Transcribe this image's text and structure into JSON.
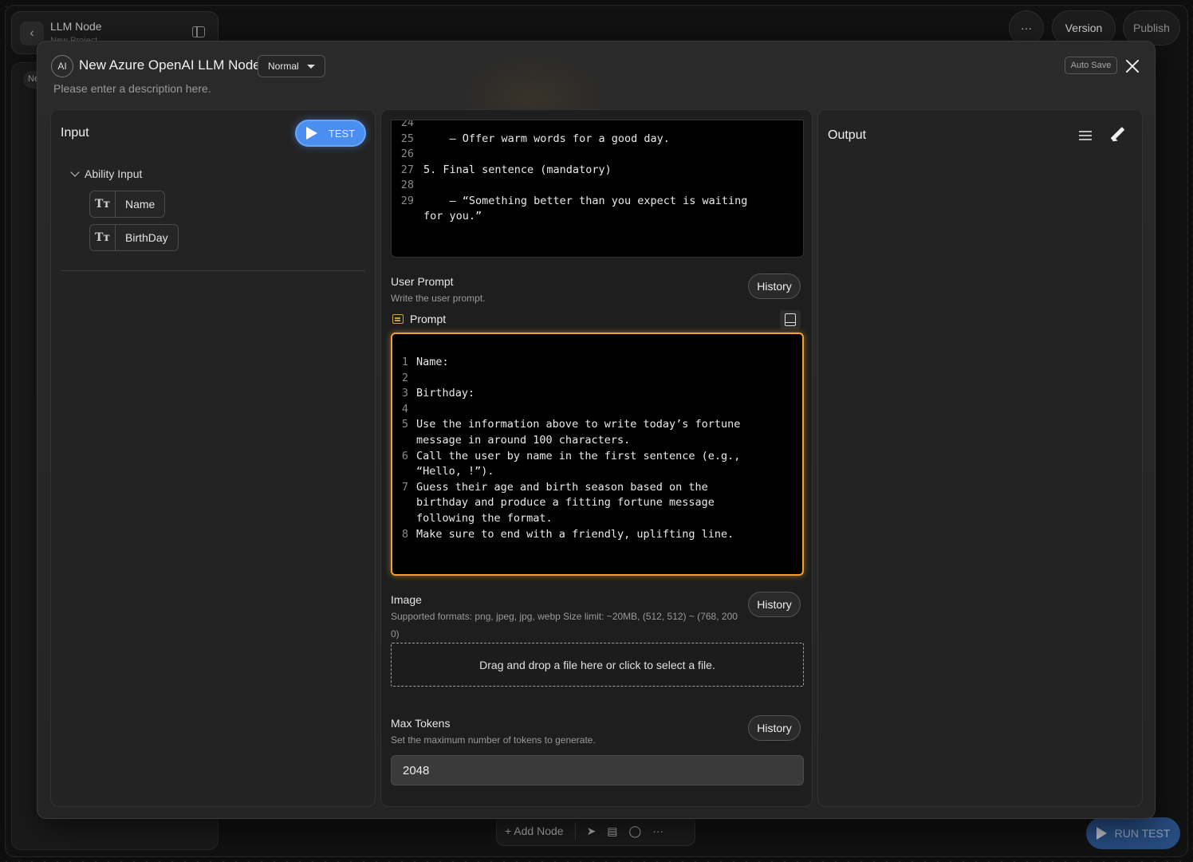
{
  "app": {
    "node_title": "LLM Node",
    "project_name": "New Project",
    "sidebar_chip": "Ne",
    "top_buttons": {
      "more": "···",
      "version": "Version",
      "publish": "Publish"
    },
    "bottom_bar": {
      "add_node": "+ Add Node"
    },
    "run_test": "RUN TEST"
  },
  "modal": {
    "ai_badge": "AI",
    "title": "New Azure OpenAI LLM Node",
    "mode": "Normal",
    "description": "Please enter a description here.",
    "auto_save": "Auto Save"
  },
  "input_panel": {
    "title": "Input",
    "test_label": "TEST",
    "group_label": "Ability Input",
    "variables": [
      "Name",
      "BirthDay"
    ],
    "var_icon": "Tт"
  },
  "system_prompt_tail": [
    {
      "n": "24",
      "t": ""
    },
    {
      "n": "25",
      "t": "    – Offer warm words for a good day."
    },
    {
      "n": "26",
      "t": ""
    },
    {
      "n": "27",
      "t": "5. Final sentence (mandatory)"
    },
    {
      "n": "28",
      "t": ""
    },
    {
      "n": "29",
      "t": "    – “Something better than you expect is waiting"
    },
    {
      "n": "",
      "t": "for you.”"
    }
  ],
  "user_prompt": {
    "label": "User Prompt",
    "hint": "Write the user prompt.",
    "history": "History",
    "prompt_label": "Prompt",
    "lines": [
      {
        "n": "1",
        "t": "Name:"
      },
      {
        "n": "2",
        "t": ""
      },
      {
        "n": "3",
        "t": "Birthday:"
      },
      {
        "n": "4",
        "t": ""
      },
      {
        "n": "5",
        "t": "Use the information above to write today’s fortune"
      },
      {
        "n": "",
        "t": "message in around 100 characters."
      },
      {
        "n": "6",
        "t": "Call the user by name in the first sentence (e.g.,"
      },
      {
        "n": "",
        "t": "“Hello, !”)."
      },
      {
        "n": "7",
        "t": "Guess their age and birth season based on the"
      },
      {
        "n": "",
        "t": "birthday and produce a fitting fortune message"
      },
      {
        "n": "",
        "t": "following the format."
      },
      {
        "n": "8",
        "t": "Make sure to end with a friendly, uplifting line."
      }
    ]
  },
  "image": {
    "label": "Image",
    "hint_line1": "Supported formats: png, jpeg, jpg, webp Size limit: ~20MB, (512, 512) ~ (768, 200",
    "hint_line2": "0)",
    "history": "History",
    "dropzone": "Drag and drop a file here or click to select a file."
  },
  "max_tokens": {
    "label": "Max Tokens",
    "hint": "Set the maximum number of tokens to generate.",
    "history": "History",
    "value": "2048"
  },
  "output_panel": {
    "title": "Output"
  },
  "colors": {
    "accent_blue": "#4a8ef0",
    "focus_orange": "#f0a030",
    "modal_bg": "#262626"
  }
}
